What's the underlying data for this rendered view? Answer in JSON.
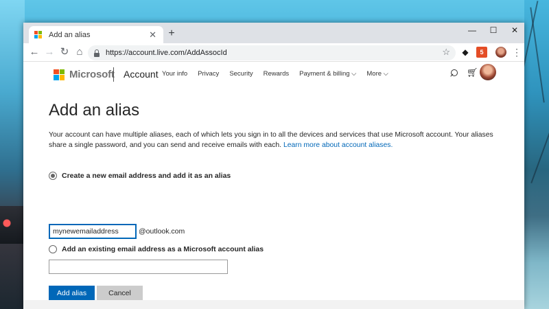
{
  "browser": {
    "tab_title": "Add an alias",
    "tab_close": "✕",
    "new_tab": "+",
    "minimize": "—",
    "maximize": "☐",
    "close": "✕",
    "url": "https://account.live.com/AddAssocId",
    "extension_html_label": "5"
  },
  "header": {
    "logo_text": "Microsoft",
    "brand": "Account",
    "nav": [
      "Your info",
      "Privacy",
      "Security",
      "Rewards",
      "Payment & billing ⌵",
      "More ⌵"
    ]
  },
  "main": {
    "title": "Add an alias",
    "description": "Your account can have multiple aliases, each of which lets you sign in to all the devices and services that use Microsoft account. Your aliases share a single password, and you can send and receive emails with each.",
    "learn_more": "Learn more about account aliases.",
    "option_new": {
      "label": "Create a new email address and add it as an alias",
      "selected": true,
      "input_value": "mynewemailaddress",
      "domain": "@outlook.com"
    },
    "option_existing": {
      "label": "Add an existing email address as a Microsoft account alias",
      "selected": false,
      "input_value": ""
    },
    "add_button": "Add alias",
    "cancel_button": "Cancel"
  },
  "colors": {
    "accent": "#0067b8",
    "ms_red": "#f25022",
    "ms_green": "#7fba00",
    "ms_blue": "#00a4ef",
    "ms_yellow": "#ffb900"
  }
}
